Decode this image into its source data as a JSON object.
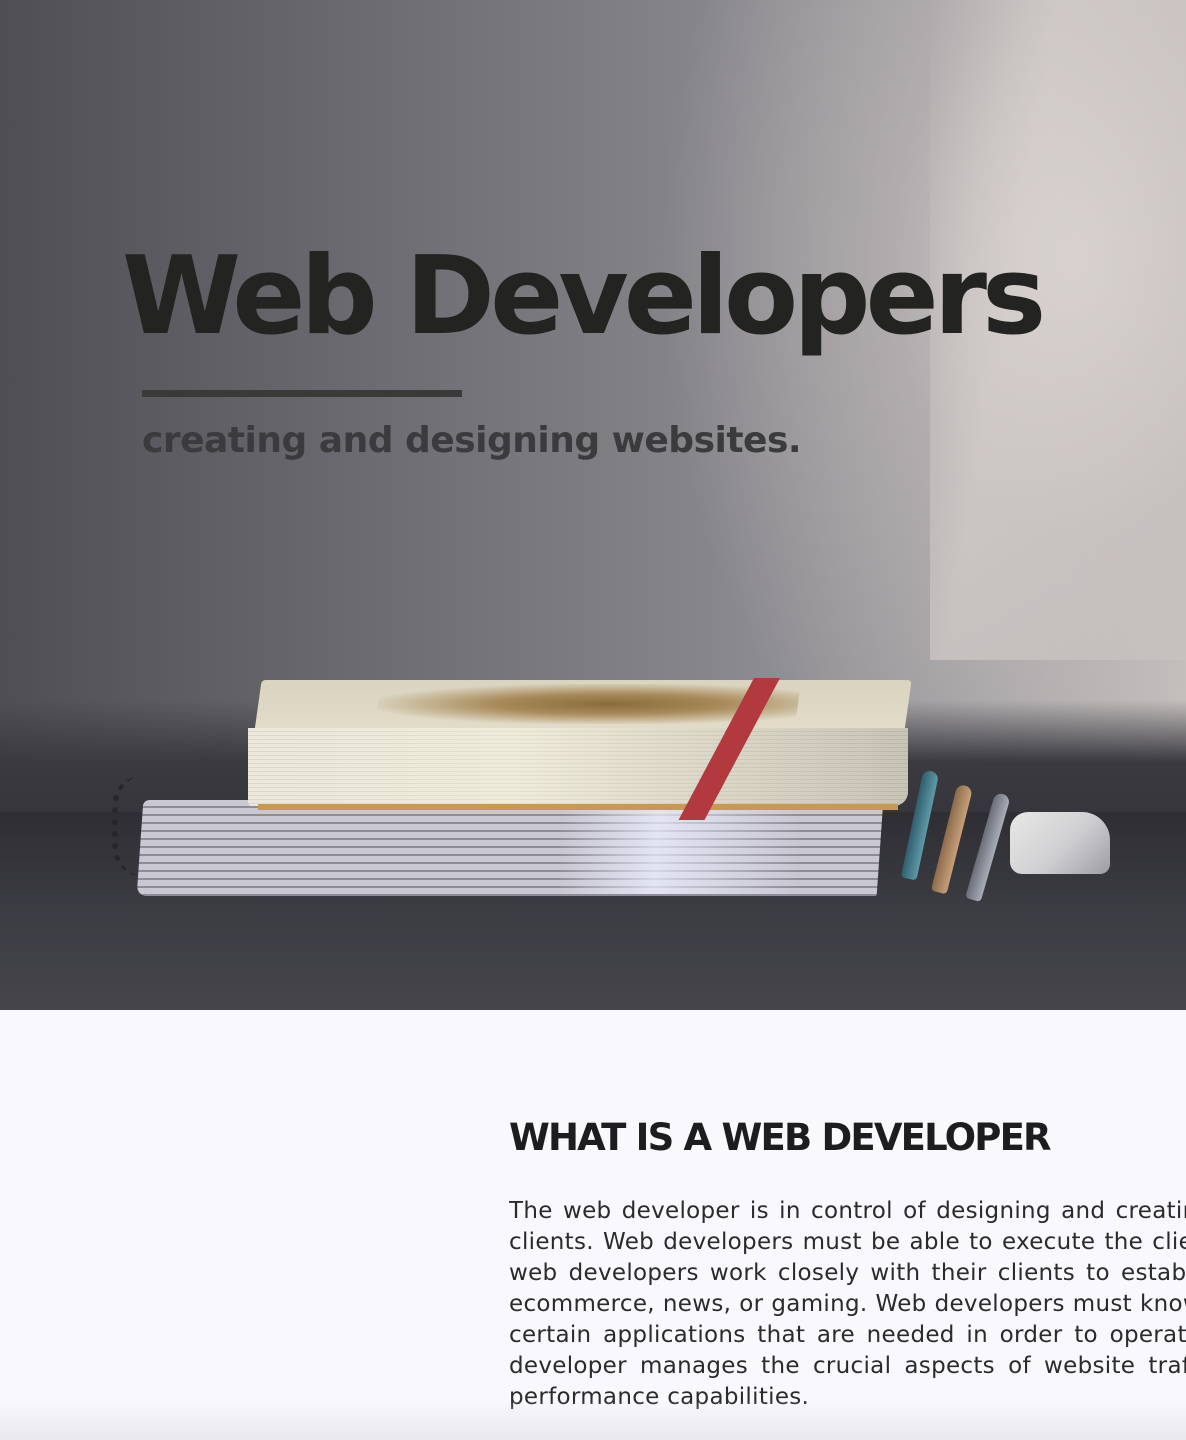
{
  "hero": {
    "title": "Web Developers",
    "subtitle": "creating and designing websites."
  },
  "about": {
    "heading": "WHAT IS A WEB DEVELOPER",
    "body": "The web developer is in control of designing and creating websites for clients. Web developers must be able to execute the clients' ideas, and web developers work closely with their clients to establish the layout, ecommerce, news, or gaming. Web developers must know how to install certain applications that are needed in order to operate the site. The developer manages the crucial aspects of website traffic and overall performance capabilities."
  },
  "colors": {
    "heading": "#1d1d1f",
    "background": "#f8f8fd",
    "hero_title": "#232321"
  }
}
